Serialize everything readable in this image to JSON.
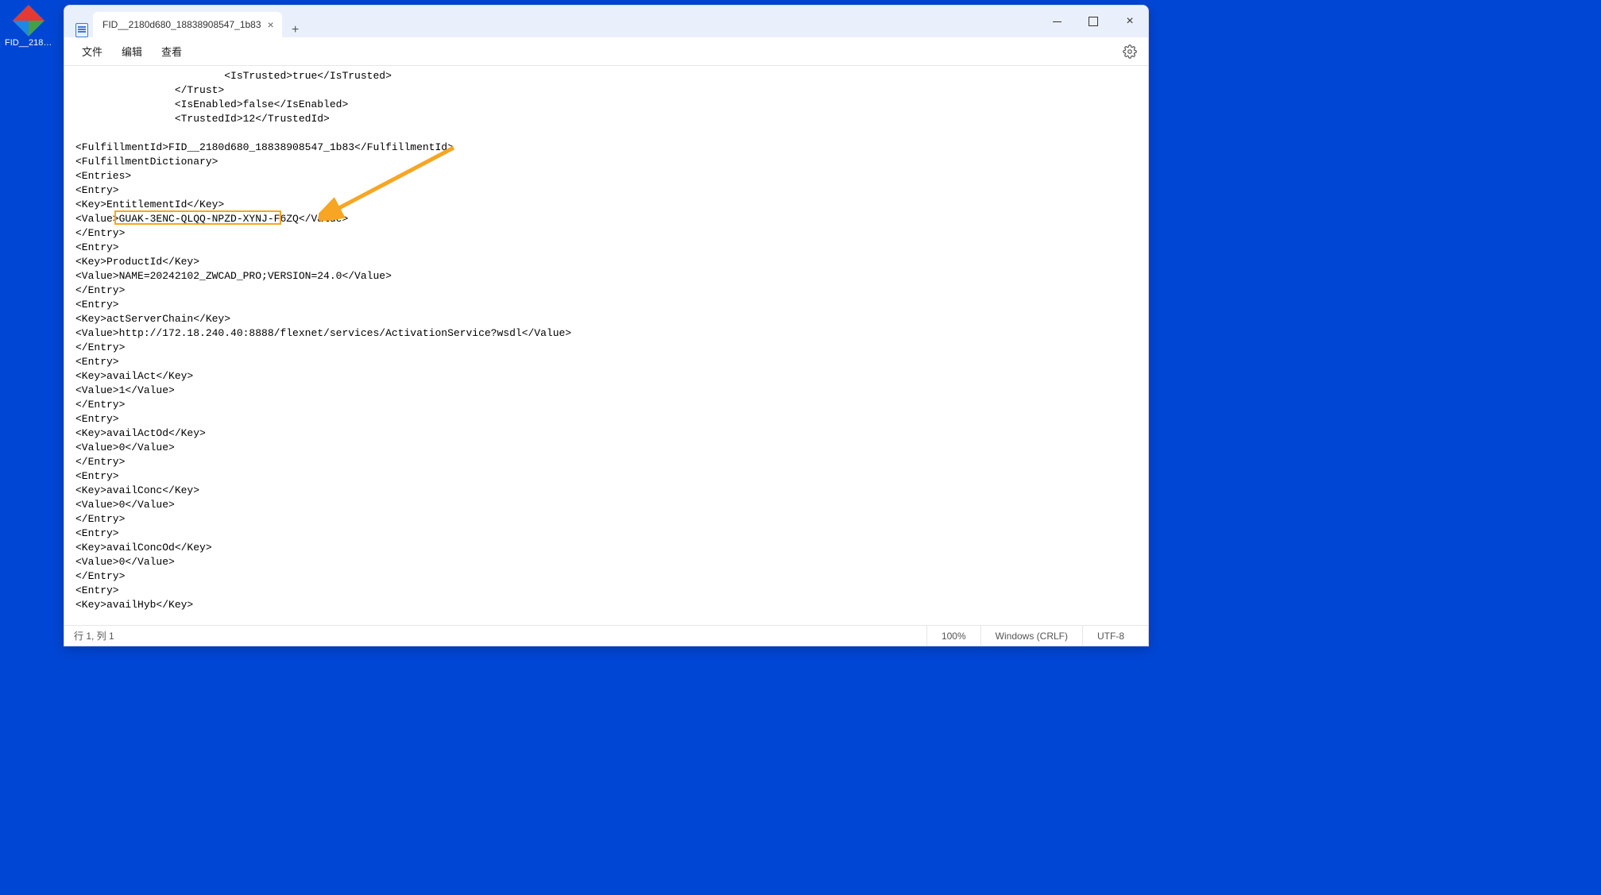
{
  "desktop": {
    "icon_label": "FID__2180..."
  },
  "window": {
    "tab_title": "FID__2180d680_18838908547_1b83",
    "menu": {
      "file": "文件",
      "edit": "编辑",
      "view": "查看"
    },
    "status": {
      "position": "行 1, 列 1",
      "zoom": "100%",
      "eol": "Windows (CRLF)",
      "encoding": "UTF-8"
    }
  },
  "annotation": {
    "highlighted_value": "GUAK-3ENC-QLQQ-NPZD-XYNJ-F6ZQ"
  },
  "document": {
    "lines": [
      "                        <IsTrusted>true</IsTrusted>",
      "                </Trust>",
      "                <IsEnabled>false</IsEnabled>",
      "                <TrustedId>12</TrustedId>",
      "",
      "<FulfillmentId>FID__2180d680_18838908547_1b83</FulfillmentId>",
      "<FulfillmentDictionary>",
      "<Entries>",
      "<Entry>",
      "<Key>EntitlementId</Key>",
      "<Value>GUAK-3ENC-QLQQ-NPZD-XYNJ-F6ZQ</Value>",
      "</Entry>",
      "<Entry>",
      "<Key>ProductId</Key>",
      "<Value>NAME=20242102_ZWCAD_PRO;VERSION=24.0</Value>",
      "</Entry>",
      "<Entry>",
      "<Key>actServerChain</Key>",
      "<Value>http://172.18.240.40:8888/flexnet/services/ActivationService?wsdl</Value>",
      "</Entry>",
      "<Entry>",
      "<Key>availAct</Key>",
      "<Value>1</Value>",
      "</Entry>",
      "<Entry>",
      "<Key>availActOd</Key>",
      "<Value>0</Value>",
      "</Entry>",
      "<Entry>",
      "<Key>availConc</Key>",
      "<Value>0</Value>",
      "</Entry>",
      "<Entry>",
      "<Key>availConcOd</Key>",
      "<Value>0</Value>",
      "</Entry>",
      "<Entry>",
      "<Key>availHyb</Key>"
    ]
  }
}
